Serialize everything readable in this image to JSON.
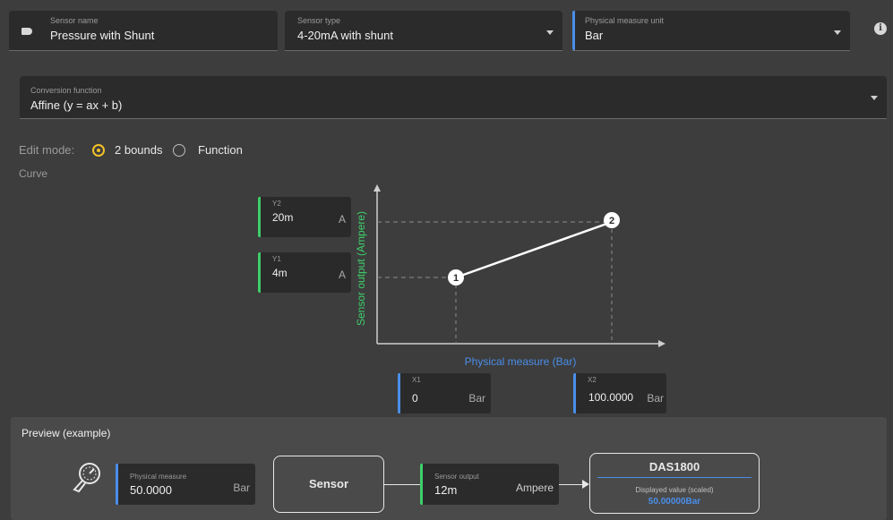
{
  "top": {
    "sensor_name": {
      "label": "Sensor name",
      "value": "Pressure with Shunt"
    },
    "sensor_type": {
      "label": "Sensor type",
      "value": "4-20mA with shunt"
    },
    "unit": {
      "label": "Physical measure unit",
      "value": "Bar"
    }
  },
  "conversion": {
    "label": "Conversion function",
    "value": "Affine (y = ax + b)"
  },
  "edit_mode": {
    "label": "Edit mode:",
    "options": [
      "2 bounds",
      "Function"
    ],
    "selected": "2 bounds"
  },
  "curve_label": "Curve",
  "chart": {
    "y_axis_label": "Sensor output (Ampere)",
    "x_axis_label": "Physical measure (Bar)",
    "point1": "1",
    "point2": "2",
    "y2": {
      "label": "Y2",
      "value": "20m",
      "unit": "A"
    },
    "y1": {
      "label": "Y1",
      "value": "4m",
      "unit": "A"
    },
    "x1": {
      "label": "X1",
      "value": "0",
      "unit": "Bar"
    },
    "x2": {
      "label": "X2",
      "value": "100.0000",
      "unit": "Bar"
    }
  },
  "preview": {
    "title": "Preview (example)",
    "physical": {
      "label": "Physical measure",
      "value": "50.0000",
      "unit": "Bar"
    },
    "sensor_label": "Sensor",
    "output": {
      "label": "Sensor output",
      "value": "12m",
      "unit": "Ampere"
    },
    "das": {
      "title": "DAS1800",
      "caption": "Displayed value (scaled)",
      "value": "50.00000Bar"
    }
  },
  "colors": {
    "green": "#3ecf6a",
    "blue": "#4a8ee8",
    "accent": "#f2c029",
    "background": "#3d3d3d"
  }
}
